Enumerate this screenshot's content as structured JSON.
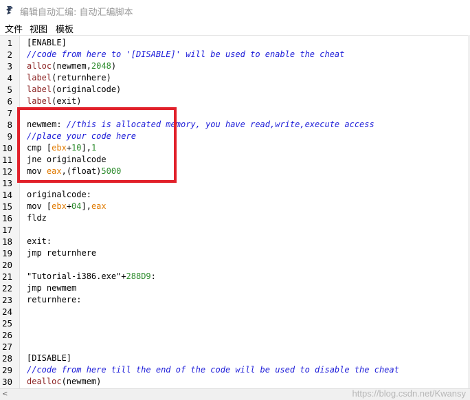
{
  "window": {
    "title": "编辑自动汇编: 自动汇编脚本",
    "icon": "cheat-engine-icon"
  },
  "menu": {
    "file": "文件",
    "view": "视图",
    "template": "模板"
  },
  "editor": {
    "lines": [
      [
        {
          "t": "[ENABLE]",
          "c": "kw"
        }
      ],
      [
        {
          "t": "//code from here to '[DISABLE]' will be used to enable the cheat",
          "c": "cm"
        }
      ],
      [
        {
          "t": "alloc",
          "c": "fn"
        },
        {
          "t": "(newmem,",
          "c": "kw"
        },
        {
          "t": "2048",
          "c": "num"
        },
        {
          "t": ")",
          "c": "kw"
        }
      ],
      [
        {
          "t": "label",
          "c": "fn"
        },
        {
          "t": "(returnhere)",
          "c": "kw"
        }
      ],
      [
        {
          "t": "label",
          "c": "fn"
        },
        {
          "t": "(originalcode)",
          "c": "kw"
        }
      ],
      [
        {
          "t": "label",
          "c": "fn"
        },
        {
          "t": "(exit)",
          "c": "kw"
        }
      ],
      [],
      [
        {
          "t": "newmem: ",
          "c": "kw"
        },
        {
          "t": "//this is allocated memory, you have read,write,execute access",
          "c": "cm"
        }
      ],
      [
        {
          "t": "//place your code here",
          "c": "cm"
        }
      ],
      [
        {
          "t": "cmp [",
          "c": "kw"
        },
        {
          "t": "ebx",
          "c": "reg"
        },
        {
          "t": "+",
          "c": "kw"
        },
        {
          "t": "10",
          "c": "num"
        },
        {
          "t": "],",
          "c": "kw"
        },
        {
          "t": "1",
          "c": "num"
        }
      ],
      [
        {
          "t": "jne originalcode",
          "c": "kw"
        }
      ],
      [
        {
          "t": "mov ",
          "c": "kw"
        },
        {
          "t": "eax",
          "c": "reg"
        },
        {
          "t": ",(float)",
          "c": "kw"
        },
        {
          "t": "5000",
          "c": "num"
        }
      ],
      [],
      [
        {
          "t": "originalcode:",
          "c": "kw"
        }
      ],
      [
        {
          "t": "mov [",
          "c": "kw"
        },
        {
          "t": "ebx",
          "c": "reg"
        },
        {
          "t": "+",
          "c": "kw"
        },
        {
          "t": "04",
          "c": "num"
        },
        {
          "t": "],",
          "c": "kw"
        },
        {
          "t": "eax",
          "c": "reg"
        }
      ],
      [
        {
          "t": "fldz",
          "c": "kw"
        }
      ],
      [],
      [
        {
          "t": "exit:",
          "c": "kw"
        }
      ],
      [
        {
          "t": "jmp returnhere",
          "c": "kw"
        }
      ],
      [],
      [
        {
          "t": "\"Tutorial-i386.exe\"",
          "c": "str"
        },
        {
          "t": "+",
          "c": "kw"
        },
        {
          "t": "288D9",
          "c": "num"
        },
        {
          "t": ":",
          "c": "kw"
        }
      ],
      [
        {
          "t": "jmp newmem",
          "c": "kw"
        }
      ],
      [
        {
          "t": "returnhere:",
          "c": "kw"
        }
      ],
      [],
      [],
      [],
      [],
      [
        {
          "t": "[DISABLE]",
          "c": "kw"
        }
      ],
      [
        {
          "t": "//code from here till the end of the code will be used to disable the cheat",
          "c": "cm"
        }
      ],
      [
        {
          "t": "dealloc",
          "c": "fn"
        },
        {
          "t": "(newmem)",
          "c": "kw"
        }
      ]
    ]
  },
  "watermark": "https://blog.csdn.net/Kwansy",
  "colors": {
    "highlight_box": "#e1202a",
    "comment": "#1b1bd8",
    "number": "#2a8a2a",
    "register": "#e07a00",
    "function": "#8a1f1f"
  }
}
